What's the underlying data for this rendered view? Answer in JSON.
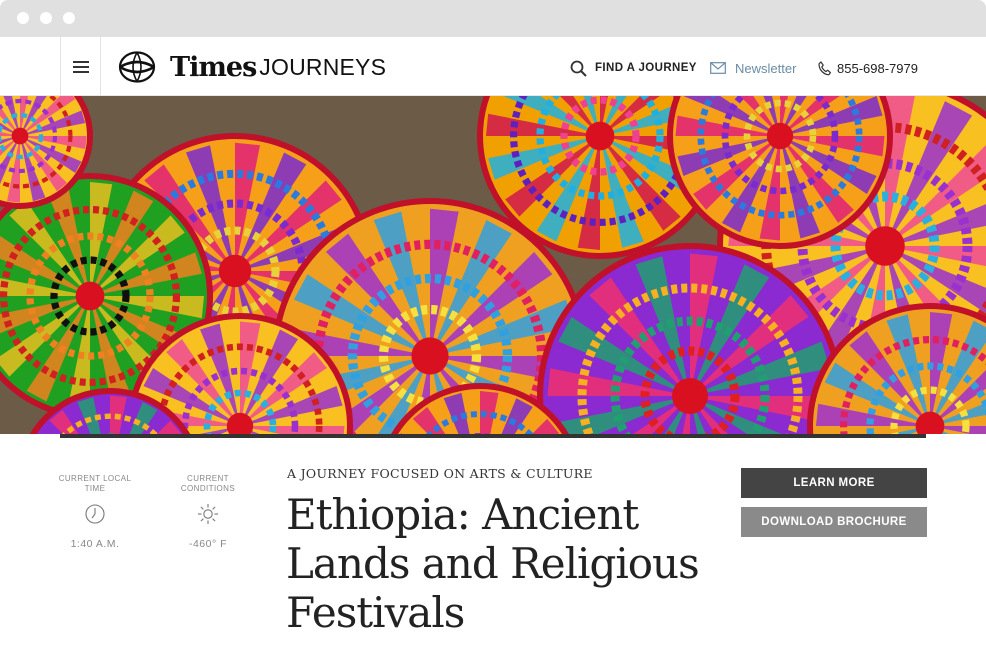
{
  "header": {
    "logo_times": "Times",
    "logo_journeys": "JOURNEYS",
    "find_label": "FIND A JOURNEY",
    "newsletter_label": "Newsletter",
    "phone": "855-698-7979"
  },
  "info": {
    "time_label": "CURRENT LOCAL TIME",
    "time_value": "1:40 A.M.",
    "conditions_label": "CURRENT CONDITIONS",
    "conditions_value": "-460° F"
  },
  "article": {
    "kicker": "A JOURNEY FOCUSED ON ARTS & CULTURE",
    "title": "Ethiopia: Ancient Lands and Religious Festivals"
  },
  "actions": {
    "learn_more": "LEARN MORE",
    "download": "DOWNLOAD BROCHURE"
  },
  "colors": {
    "accent_link": "#6a8ba6",
    "button_dark": "#444444",
    "button_gray": "#8a8a8a"
  },
  "icons": [
    "menu-icon",
    "globe-icon",
    "search-icon",
    "envelope-icon",
    "phone-icon",
    "clock-icon",
    "sun-icon"
  ]
}
